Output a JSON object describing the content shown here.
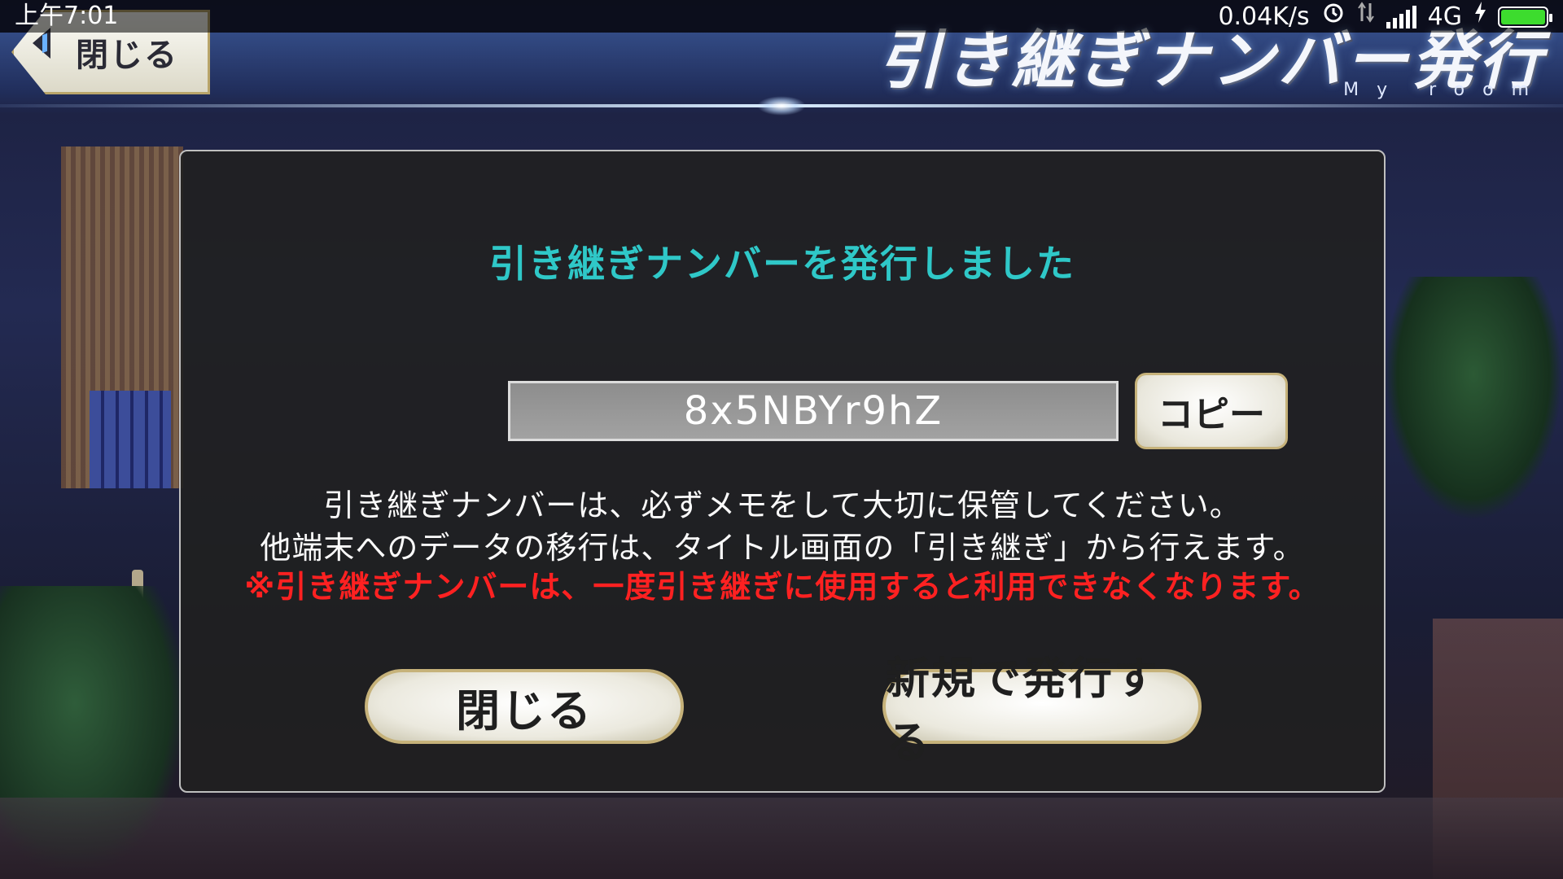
{
  "status_bar": {
    "time": "上午7:01",
    "network_speed": "0.04K/s",
    "network_type": "4G",
    "icons": [
      "alarm-icon",
      "data-transfer-icon",
      "signal-bars-icon",
      "charging-icon",
      "battery-icon"
    ]
  },
  "header": {
    "back_label": "閉じる",
    "title": "引き継ぎナンバー発行",
    "subtitle": "My room"
  },
  "dialog": {
    "title": "引き継ぎナンバーを発行しました",
    "transfer_code": "8x5NBYr9hZ",
    "copy_label": "コピー",
    "message_line1": "引き継ぎナンバーは、必ずメモをして大切に保管してください。",
    "message_line2": "他端末へのデータの移行は、タイトル画面の「引き継ぎ」から行えます。",
    "warning": "※引き継ぎナンバーは、一度引き継ぎに使用すると利用できなくなります。",
    "close_label": "閉じる",
    "reissue_label": "新規で発行する"
  },
  "colors": {
    "title_accent": "#2fc8c8",
    "warning": "#ff2121",
    "button_border": "#c6b27a",
    "battery": "#3ddc2e"
  }
}
